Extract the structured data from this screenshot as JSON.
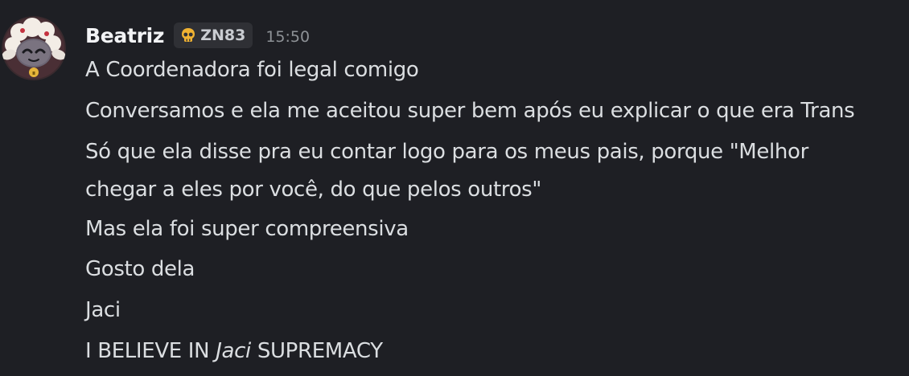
{
  "message": {
    "author": "Beatriz",
    "tag": {
      "icon": "skull-icon",
      "label": "ZN83"
    },
    "timestamp": "15:50",
    "avatar": "lamb-avatar",
    "lines": [
      "A Coordenadora foi legal comigo",
      "Conversamos e ela me aceitou super bem após eu explicar o que era Trans",
      "Só que ela disse pra eu contar logo para os meus pais, porque \"Melhor",
      "chegar a eles por você, do que pelos outros\"",
      "Mas ela foi super compreensiva",
      "Gosto dela",
      "Jaci"
    ],
    "last_line": {
      "before": "I BELIEVE IN",
      "italic": "Jaci",
      "after": " SUPREMACY"
    }
  },
  "colors": {
    "background": "#1e1f24",
    "text": "#dbdee1",
    "username": "#f2f3f5",
    "tag_bg": "#2f3035",
    "timestamp": "#8e9297",
    "skull": "#f0b232"
  }
}
